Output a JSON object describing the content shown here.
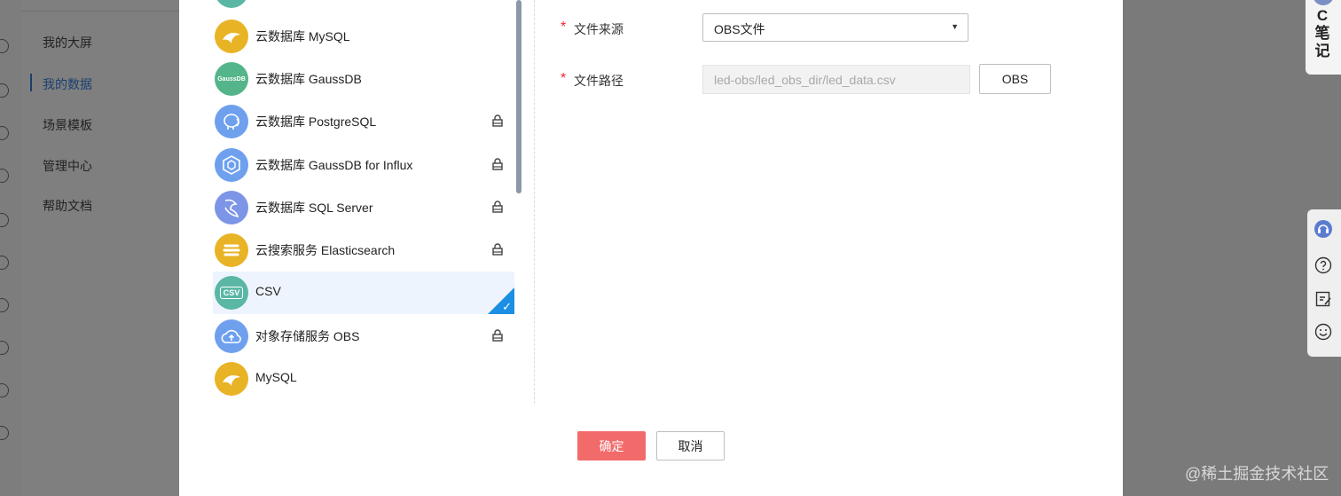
{
  "background_nav": {
    "items": [
      "我的大屏",
      "我的数据",
      "场景模板",
      "管理中心",
      "帮助文档"
    ],
    "active_index": 1
  },
  "datasource_list": [
    {
      "label": "云数据库 MySQL",
      "icon": "mysql-dolphin-icon",
      "color": "#e9b326",
      "locked": false,
      "selected": false
    },
    {
      "label": "云数据库 GaussDB",
      "icon": "gaussdb-icon",
      "icon_text": "GaussDB",
      "color": "#55b58a",
      "locked": false,
      "selected": false
    },
    {
      "label": "云数据库 PostgreSQL",
      "icon": "postgresql-elephant-icon",
      "color": "#6ea0ee",
      "locked": true,
      "selected": false
    },
    {
      "label": "云数据库 GaussDB for Influx",
      "icon": "influx-hexagon-icon",
      "color": "#6ea0ee",
      "locked": true,
      "selected": false
    },
    {
      "label": "云数据库 SQL Server",
      "icon": "sqlserver-icon",
      "color": "#7c95e6",
      "locked": true,
      "selected": false
    },
    {
      "label": "云搜索服务 Elasticsearch",
      "icon": "elasticsearch-icon",
      "color": "#e9b326",
      "locked": true,
      "selected": false
    },
    {
      "label": "CSV",
      "icon": "csv-file-icon",
      "icon_text": "CSV",
      "color": "#5ab7a4",
      "locked": false,
      "selected": true
    },
    {
      "label": "对象存储服务 OBS",
      "icon": "obs-cloud-icon",
      "color": "#6ea0ee",
      "locked": true,
      "selected": false
    },
    {
      "label": "MySQL",
      "icon": "mysql-dolphin-icon",
      "color": "#e9b326",
      "locked": false,
      "selected": false
    }
  ],
  "form": {
    "source_label": "文件来源",
    "source_value": "OBS文件",
    "path_label": "文件路径",
    "path_value": "led-obs/led_obs_dir/led_data.csv",
    "obs_button": "OBS",
    "required_mark": "*"
  },
  "footer": {
    "ok": "确定",
    "cancel": "取消"
  },
  "side_tools": {
    "note_label": "C笔记"
  },
  "watermark": "@稀土掘金技术社区",
  "colors": {
    "accent": "#1a8fe3",
    "ok_button": "#f26b6b",
    "required": "#f5222d"
  }
}
